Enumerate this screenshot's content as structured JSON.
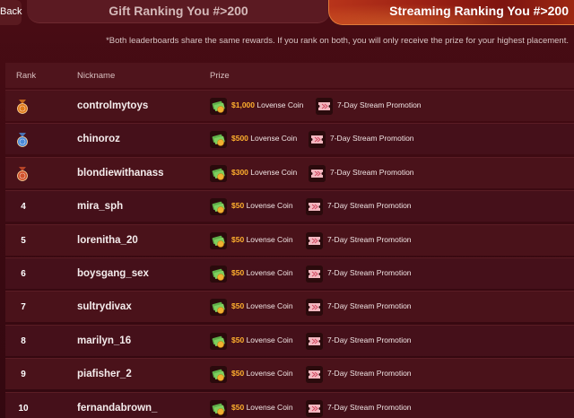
{
  "nav": {
    "back_label": "Back",
    "tab_gift": "Gift Ranking You #>200",
    "tab_stream": "Streaming Ranking You #>200"
  },
  "note": "*Both leaderboards share the same rewards. If you rank on both, you will only receive the prize for your highest placement.",
  "table": {
    "headers": {
      "rank": "Rank",
      "nickname": "Nickname",
      "prize": "Prize"
    },
    "rows": [
      {
        "rank": "1",
        "medal": "gold",
        "nickname": "controlmytoys",
        "coin_amount": "$1,000",
        "coin_label": "Lovense Coin",
        "promo_label": "7-Day Stream Promotion"
      },
      {
        "rank": "2",
        "medal": "silver",
        "nickname": "chinoroz",
        "coin_amount": "$500",
        "coin_label": "Lovense Coin",
        "promo_label": "7-Day Stream Promotion"
      },
      {
        "rank": "3",
        "medal": "bronze",
        "nickname": "blondiewithanass",
        "coin_amount": "$300",
        "coin_label": "Lovense Coin",
        "promo_label": "7-Day Stream Promotion"
      },
      {
        "rank": "4",
        "medal": "",
        "nickname": "mira_sph",
        "coin_amount": "$50",
        "coin_label": "Lovense Coin",
        "promo_label": "7-Day Stream Promotion"
      },
      {
        "rank": "5",
        "medal": "",
        "nickname": "lorenitha_20",
        "coin_amount": "$50",
        "coin_label": "Lovense Coin",
        "promo_label": "7-Day Stream Promotion"
      },
      {
        "rank": "6",
        "medal": "",
        "nickname": "boysgang_sex",
        "coin_amount": "$50",
        "coin_label": "Lovense Coin",
        "promo_label": "7-Day Stream Promotion"
      },
      {
        "rank": "7",
        "medal": "",
        "nickname": "sultrydivax",
        "coin_amount": "$50",
        "coin_label": "Lovense Coin",
        "promo_label": "7-Day Stream Promotion"
      },
      {
        "rank": "8",
        "medal": "",
        "nickname": "marilyn_16",
        "coin_amount": "$50",
        "coin_label": "Lovense Coin",
        "promo_label": "7-Day Stream Promotion"
      },
      {
        "rank": "9",
        "medal": "",
        "nickname": "piafisher_2",
        "coin_amount": "$50",
        "coin_label": "Lovense Coin",
        "promo_label": "7-Day Stream Promotion"
      },
      {
        "rank": "10",
        "medal": "",
        "nickname": "fernandabrown_",
        "coin_amount": "$50",
        "coin_label": "Lovense Coin",
        "promo_label": "7-Day Stream Promotion"
      }
    ]
  },
  "icons": {
    "coin": "cash-coin-icon",
    "ticket": "ticket-icon",
    "medal": "medal-icon"
  },
  "colors": {
    "accent": "#ffb02e",
    "background": "#3d0a12",
    "medal_gold": "#e07a1a",
    "medal_silver": "#4a8ad8",
    "medal_bronze": "#d0502a"
  }
}
